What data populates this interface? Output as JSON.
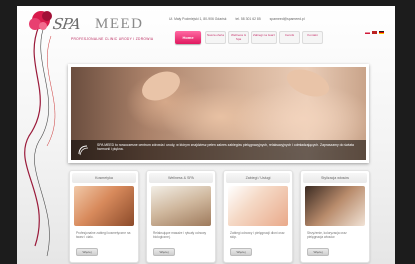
{
  "brand": {
    "script": "SPA",
    "word": "MEED",
    "tagline": "PROFESJONALNE CLINIC URODY I ZDROWIA"
  },
  "contact": {
    "address": "Ul. Mały Podmiejski 1, 80-906 Gdańsk",
    "phone": "tel. 58 301 62 85",
    "email": "spameed@spameed.pl"
  },
  "nav": {
    "home": "Home",
    "items": [
      "Nasza oferta",
      "Wellness & Spa",
      "Zabiegi na twarz",
      "Cennik",
      "Kontakt"
    ]
  },
  "hero": {
    "caption": "SPA MEED to nowoczesne centrum zdrowia i urody, w którym znajdziesz pełen zakres zabiegów pielęgnacyjnych, relaksacyjnych i odmładzających. Zapraszamy do świata harmonii i piękna."
  },
  "cards": [
    {
      "title": "Kosmetyka",
      "text": "Profesjonalne zabiegi kosmetyczne na twarz i ciało.",
      "button": "Więcej"
    },
    {
      "title": "Wellness & SPA",
      "text": "Relaksujące masaże i rytuały odnowy biologicznej.",
      "button": "Więcej"
    },
    {
      "title": "Zabiegi / Usługi",
      "text": "Zabiegi odnowy i pielęgnacji dłoni oraz stóp.",
      "button": "Więcej"
    },
    {
      "title": "Stylizacja włosów",
      "text": "Strzyżenie, koloryzacja oraz pielęgnacja włosów.",
      "button": "Więcej"
    }
  ],
  "colors": {
    "accent": "#e0185f",
    "page_bg": "#1c1c1c"
  }
}
